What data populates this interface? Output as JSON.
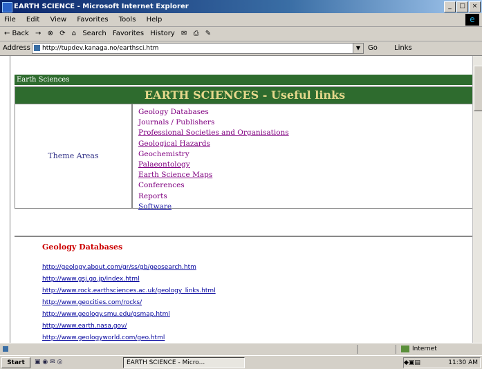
{
  "window": {
    "title": "EARTH SCIENCE - Microsoft Internet Explorer",
    "buttons": [
      "_",
      "□",
      "×"
    ]
  },
  "menubar": [
    "File",
    "Edit",
    "View",
    "Favorites",
    "Tools",
    "Help"
  ],
  "toolbar": {
    "back": "← Back",
    "forward": "→",
    "stop": "⊗",
    "refresh": "⟳",
    "home": "⌂",
    "search": "Search",
    "favorites": "Favorites",
    "history": "History",
    "mail": "✉",
    "print": "⎙",
    "edit": "✎"
  },
  "addressbar": {
    "label": "Address",
    "url": "http://tupdev.kanaga.no/earthsci.htm",
    "go": "Go",
    "links": "Links"
  },
  "page": {
    "breadcrumb": "Earth Sciences",
    "banner": "EARTH SCIENCES - Useful links",
    "theme_label": "Theme Areas",
    "theme_links": [
      "Geology Databases",
      "Journals / Publishers",
      "Professional Societies and Organisations",
      "Geological Hazards",
      "Geochemistry",
      "Palaeontology",
      "Earth Science Maps",
      "Conferences",
      "Reports",
      "Software"
    ],
    "section_title": "Geology Databases",
    "urls": [
      "http://geology.about.com/gr/ss/gb/geosearch.htm",
      "http://www.gsj.go.jp/index.html",
      "http://www.rock.earthsciences.ac.uk/geology_links.html",
      "http://www.geocities.com/rocks/",
      "http://www.geology.smu.edu/gsmap.html",
      "http://www.earth.nasa.gov/",
      "http://www.geologyworld.com/geo.html"
    ]
  },
  "statusbar": {
    "zone": "Internet"
  },
  "taskbar": {
    "start": "Start",
    "task": "EARTH SCIENCE - Micro...",
    "clock": "11:30 AM"
  }
}
